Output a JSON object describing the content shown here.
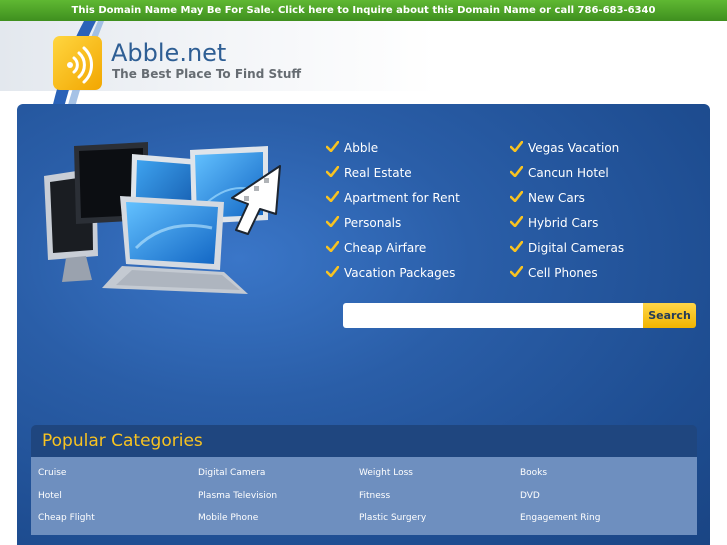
{
  "banner": {
    "text": "This Domain Name May Be For Sale. Click here to Inquire about this Domain Name or call 786-683-6340"
  },
  "header": {
    "title": "Abble.net",
    "tagline": "The Best Place To Find Stuff"
  },
  "links": {
    "left": [
      "Abble",
      "Real Estate",
      "Apartment for Rent",
      "Personals",
      "Cheap Airfare",
      "Vacation Packages"
    ],
    "right": [
      "Vegas Vacation",
      "Cancun Hotel",
      "New Cars",
      "Hybrid Cars",
      "Digital Cameras",
      "Cell Phones"
    ]
  },
  "search": {
    "value": "",
    "button_label": "Search"
  },
  "categories": {
    "title": "Popular Categories",
    "columns": [
      [
        "Cruise",
        "Hotel",
        "Cheap Flight"
      ],
      [
        "Digital Camera",
        "Plasma Television",
        "Mobile Phone"
      ],
      [
        "Weight Loss",
        "Fitness",
        "Plastic Surgery"
      ],
      [
        "Books",
        "DVD",
        "Engagement Ring"
      ]
    ]
  },
  "colors": {
    "banner": "#4ca428",
    "brand": "#2e5e94",
    "panel": "#2a5ea8",
    "accent": "#f8c321",
    "category_header": "#1f467f",
    "category_body": "#6e8fbf"
  },
  "icons": {
    "logo": "wireless-signal-icon",
    "bullet": "checkmark-icon"
  }
}
